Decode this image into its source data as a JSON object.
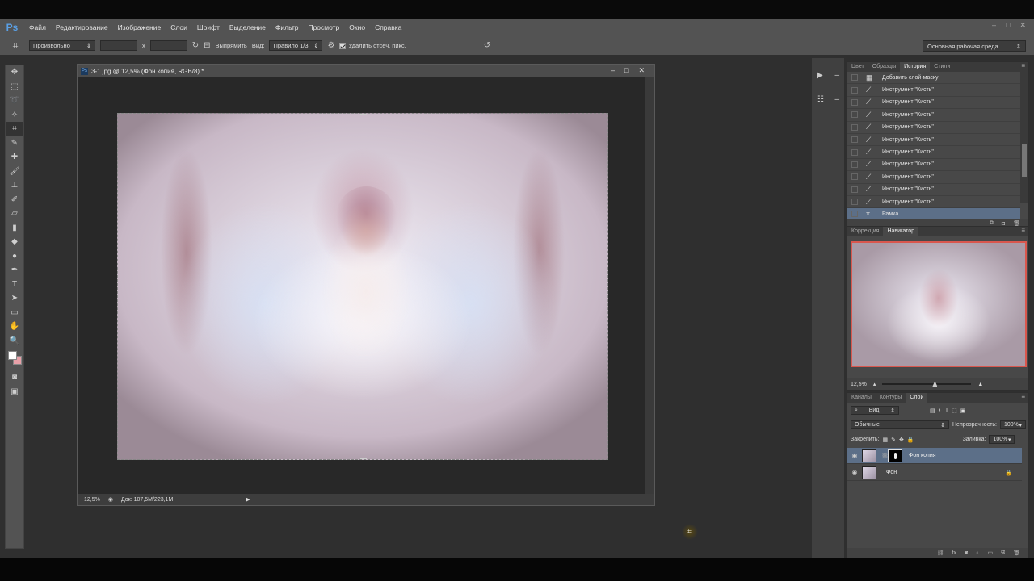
{
  "app": {
    "logo": "Ps",
    "menu": [
      "Файл",
      "Редактирование",
      "Изображение",
      "Слои",
      "Шрифт",
      "Выделение",
      "Фильтр",
      "Просмотр",
      "Окно",
      "Справка"
    ],
    "window_controls": [
      "–",
      "□",
      "✕"
    ]
  },
  "options": {
    "ratio": "Произвольно",
    "ratio_sep": "x",
    "clear_label": "Выпрямить",
    "view_label": "Вид:",
    "view_value": "Правило 1/3",
    "delete_cropped_label": "Удалить отсеч. пикс.",
    "workspace": "Основная рабочая среда"
  },
  "document": {
    "title": "3-1.jpg @ 12,5% (Фон копия, RGB/8) *",
    "zoom": "12,5%",
    "doc_size": "Док: 107,5M/223,1M",
    "controls": [
      "–",
      "□",
      "✕"
    ]
  },
  "history_panel": {
    "tabs": [
      "Цвет",
      "Образцы",
      "История",
      "Стили"
    ],
    "active_tab": "История",
    "items": [
      "Добавить слой-маску",
      "Инструмент \"Кисть\"",
      "Инструмент \"Кисть\"",
      "Инструмент \"Кисть\"",
      "Инструмент \"Кисть\"",
      "Инструмент \"Кисть\"",
      "Инструмент \"Кисть\"",
      "Инструмент \"Кисть\"",
      "Инструмент \"Кисть\"",
      "Инструмент \"Кисть\"",
      "Инструмент \"Кисть\"",
      "Рамка"
    ],
    "selected_index": 11
  },
  "navigator_panel": {
    "tabs": [
      "Коррекция",
      "Навигатор"
    ],
    "active_tab": "Навигатор",
    "zoom": "12,5%",
    "zoom_level": 0.55
  },
  "layers_panel": {
    "tabs": [
      "Каналы",
      "Контуры",
      "Слои"
    ],
    "active_tab": "Слои",
    "filter": "Вид",
    "blend_mode": "Обычные",
    "opacity_label": "Непрозрачность:",
    "opacity": "100%",
    "lock_label": "Закрепить:",
    "fill_label": "Заливка:",
    "fill": "100%",
    "layers": [
      {
        "name": "Фон копия",
        "selected": true
      },
      {
        "name": "Фон",
        "selected": false
      }
    ]
  },
  "colors": {
    "foreground": "#ffffff",
    "background": "#e8a0a8",
    "selection": "#5c6f88",
    "nav_frame": "#d9574e"
  }
}
